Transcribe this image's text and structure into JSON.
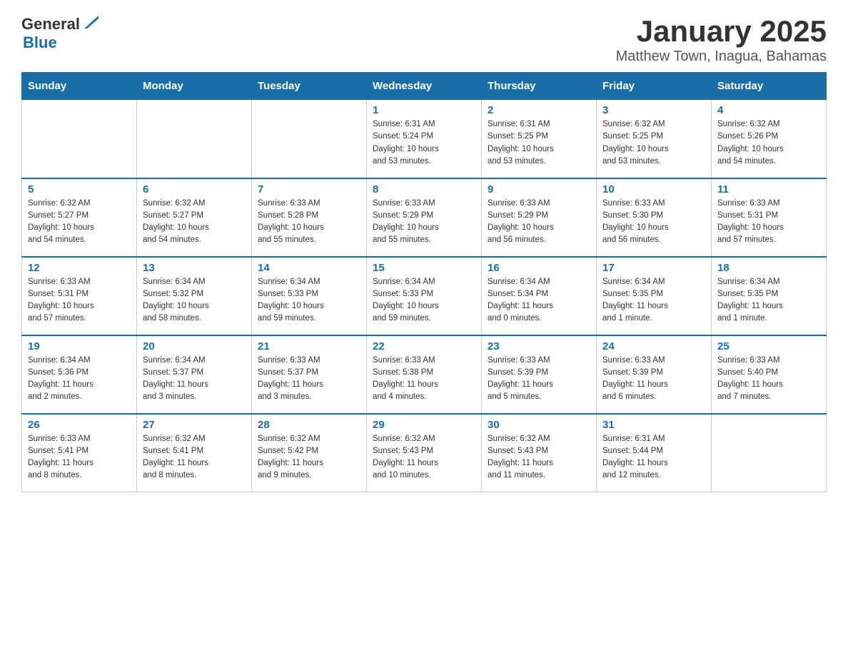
{
  "header": {
    "title": "January 2025",
    "subtitle": "Matthew Town, Inagua, Bahamas",
    "logo_general": "General",
    "logo_blue": "Blue"
  },
  "columns": [
    "Sunday",
    "Monday",
    "Tuesday",
    "Wednesday",
    "Thursday",
    "Friday",
    "Saturday"
  ],
  "weeks": [
    [
      {
        "day": "",
        "info": ""
      },
      {
        "day": "",
        "info": ""
      },
      {
        "day": "",
        "info": ""
      },
      {
        "day": "1",
        "info": "Sunrise: 6:31 AM\nSunset: 5:24 PM\nDaylight: 10 hours\nand 53 minutes."
      },
      {
        "day": "2",
        "info": "Sunrise: 6:31 AM\nSunset: 5:25 PM\nDaylight: 10 hours\nand 53 minutes."
      },
      {
        "day": "3",
        "info": "Sunrise: 6:32 AM\nSunset: 5:25 PM\nDaylight: 10 hours\nand 53 minutes."
      },
      {
        "day": "4",
        "info": "Sunrise: 6:32 AM\nSunset: 5:26 PM\nDaylight: 10 hours\nand 54 minutes."
      }
    ],
    [
      {
        "day": "5",
        "info": "Sunrise: 6:32 AM\nSunset: 5:27 PM\nDaylight: 10 hours\nand 54 minutes."
      },
      {
        "day": "6",
        "info": "Sunrise: 6:32 AM\nSunset: 5:27 PM\nDaylight: 10 hours\nand 54 minutes."
      },
      {
        "day": "7",
        "info": "Sunrise: 6:33 AM\nSunset: 5:28 PM\nDaylight: 10 hours\nand 55 minutes."
      },
      {
        "day": "8",
        "info": "Sunrise: 6:33 AM\nSunset: 5:29 PM\nDaylight: 10 hours\nand 55 minutes."
      },
      {
        "day": "9",
        "info": "Sunrise: 6:33 AM\nSunset: 5:29 PM\nDaylight: 10 hours\nand 56 minutes."
      },
      {
        "day": "10",
        "info": "Sunrise: 6:33 AM\nSunset: 5:30 PM\nDaylight: 10 hours\nand 56 minutes."
      },
      {
        "day": "11",
        "info": "Sunrise: 6:33 AM\nSunset: 5:31 PM\nDaylight: 10 hours\nand 57 minutes."
      }
    ],
    [
      {
        "day": "12",
        "info": "Sunrise: 6:33 AM\nSunset: 5:31 PM\nDaylight: 10 hours\nand 57 minutes."
      },
      {
        "day": "13",
        "info": "Sunrise: 6:34 AM\nSunset: 5:32 PM\nDaylight: 10 hours\nand 58 minutes."
      },
      {
        "day": "14",
        "info": "Sunrise: 6:34 AM\nSunset: 5:33 PM\nDaylight: 10 hours\nand 59 minutes."
      },
      {
        "day": "15",
        "info": "Sunrise: 6:34 AM\nSunset: 5:33 PM\nDaylight: 10 hours\nand 59 minutes."
      },
      {
        "day": "16",
        "info": "Sunrise: 6:34 AM\nSunset: 5:34 PM\nDaylight: 11 hours\nand 0 minutes."
      },
      {
        "day": "17",
        "info": "Sunrise: 6:34 AM\nSunset: 5:35 PM\nDaylight: 11 hours\nand 1 minute."
      },
      {
        "day": "18",
        "info": "Sunrise: 6:34 AM\nSunset: 5:35 PM\nDaylight: 11 hours\nand 1 minute."
      }
    ],
    [
      {
        "day": "19",
        "info": "Sunrise: 6:34 AM\nSunset: 5:36 PM\nDaylight: 11 hours\nand 2 minutes."
      },
      {
        "day": "20",
        "info": "Sunrise: 6:34 AM\nSunset: 5:37 PM\nDaylight: 11 hours\nand 3 minutes."
      },
      {
        "day": "21",
        "info": "Sunrise: 6:33 AM\nSunset: 5:37 PM\nDaylight: 11 hours\nand 3 minutes."
      },
      {
        "day": "22",
        "info": "Sunrise: 6:33 AM\nSunset: 5:38 PM\nDaylight: 11 hours\nand 4 minutes."
      },
      {
        "day": "23",
        "info": "Sunrise: 6:33 AM\nSunset: 5:39 PM\nDaylight: 11 hours\nand 5 minutes."
      },
      {
        "day": "24",
        "info": "Sunrise: 6:33 AM\nSunset: 5:39 PM\nDaylight: 11 hours\nand 6 minutes."
      },
      {
        "day": "25",
        "info": "Sunrise: 6:33 AM\nSunset: 5:40 PM\nDaylight: 11 hours\nand 7 minutes."
      }
    ],
    [
      {
        "day": "26",
        "info": "Sunrise: 6:33 AM\nSunset: 5:41 PM\nDaylight: 11 hours\nand 8 minutes."
      },
      {
        "day": "27",
        "info": "Sunrise: 6:32 AM\nSunset: 5:41 PM\nDaylight: 11 hours\nand 8 minutes."
      },
      {
        "day": "28",
        "info": "Sunrise: 6:32 AM\nSunset: 5:42 PM\nDaylight: 11 hours\nand 9 minutes."
      },
      {
        "day": "29",
        "info": "Sunrise: 6:32 AM\nSunset: 5:43 PM\nDaylight: 11 hours\nand 10 minutes."
      },
      {
        "day": "30",
        "info": "Sunrise: 6:32 AM\nSunset: 5:43 PM\nDaylight: 11 hours\nand 11 minutes."
      },
      {
        "day": "31",
        "info": "Sunrise: 6:31 AM\nSunset: 5:44 PM\nDaylight: 11 hours\nand 12 minutes."
      },
      {
        "day": "",
        "info": ""
      }
    ]
  ]
}
